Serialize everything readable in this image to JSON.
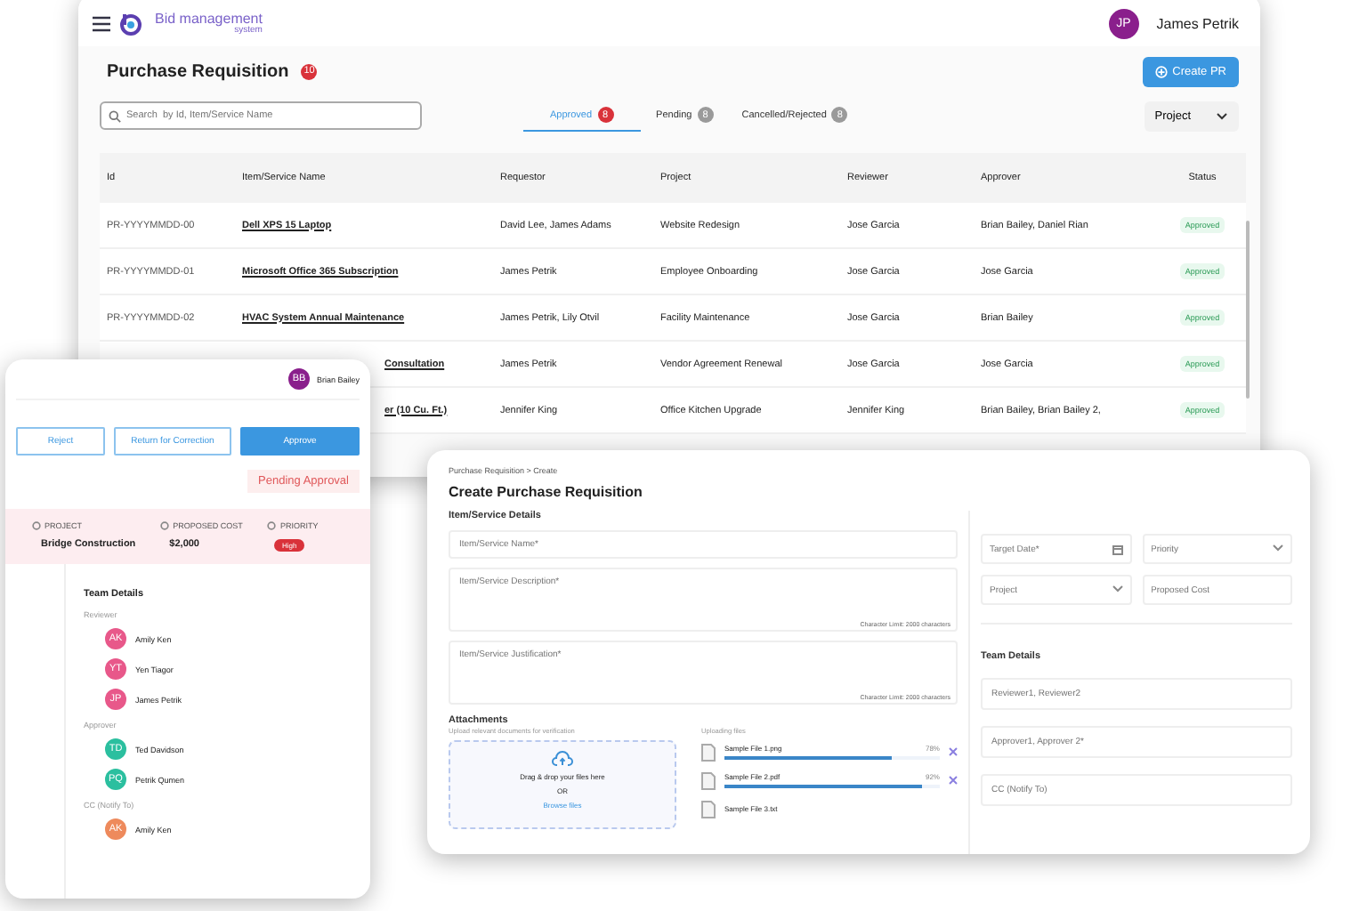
{
  "main_window": {
    "app": {
      "name": "Bid management",
      "tagline": "system"
    },
    "user": {
      "initials": "JP",
      "name": "James Petrik"
    },
    "page": {
      "title": "Purchase Requisition",
      "count": "10",
      "create_button": "Create PR"
    },
    "search": {
      "placeholder": "Search  by Id, Item/Service Name"
    },
    "tabs": [
      {
        "label": "Approved",
        "count": "8",
        "selected": true
      },
      {
        "label": "Pending",
        "count": "8",
        "selected": false
      },
      {
        "label": "Cancelled/Rejected",
        "count": "8",
        "selected": false
      }
    ],
    "filter": {
      "label": "Project"
    },
    "table": {
      "columns": [
        "Id",
        "Item/Service Name",
        "Requestor",
        "Project",
        "Reviewer",
        "Approver",
        "Status"
      ],
      "rows": [
        {
          "id": "PR-YYYYMMDD-00",
          "item": "Dell XPS 15 Laptop",
          "requestor": "David Lee, James Adams",
          "project": "Website Redesign",
          "reviewer": "Jose Garcia",
          "approver": "Brian Bailey, Daniel Rian",
          "status": "Approved"
        },
        {
          "id": "PR-YYYYMMDD-01",
          "item": "Microsoft Office 365 Subscription",
          "requestor": "James Petrik",
          "project": "Employee Onboarding",
          "reviewer": "Jose Garcia",
          "approver": "Jose Garcia",
          "status": "Approved"
        },
        {
          "id": "PR-YYYYMMDD-02",
          "item": "HVAC System Annual Maintenance",
          "requestor": "James Petrik, Lily Otvil",
          "project": "Facility Maintenance",
          "reviewer": "Jose Garcia",
          "approver": "Brian Bailey",
          "status": "Approved"
        },
        {
          "item": "Consultation",
          "requestor": "James Petrik",
          "project": "Vendor Agreement Renewal",
          "reviewer": "Jose Garcia",
          "approver": "Jose Garcia",
          "status": "Approved"
        },
        {
          "item": "er (10 Cu. Ft.)",
          "requestor": "Jennifer King",
          "project": "Office Kitchen Upgrade",
          "reviewer": "Jennifer King",
          "approver": "Brian Bailey, Brian Bailey 2,",
          "status": "Approved"
        }
      ]
    }
  },
  "review_panel": {
    "user": {
      "initials": "BB",
      "name": "Brian Bailey"
    },
    "actions": [
      {
        "label": "Reject",
        "kind": "outline"
      },
      {
        "label": "Return for Correction",
        "kind": "outline"
      },
      {
        "label": "Approve",
        "kind": "primary"
      }
    ],
    "status": "Pending Approval",
    "summary": [
      {
        "label": "PROJECT",
        "value": "Bridge Construction",
        "kind": "text"
      },
      {
        "label": "PROPOSED COST",
        "value": "$2,000",
        "kind": "text"
      },
      {
        "label": "PRIORITY",
        "value": "High",
        "kind": "tag"
      }
    ],
    "team_title": "Team Details",
    "groups": [
      {
        "label": "Reviewer",
        "members": [
          {
            "initials": "AK",
            "name": "Amily Ken",
            "color": "#e8588a"
          },
          {
            "initials": "YT",
            "name": "Yen Tiagor",
            "color": "#e8588a"
          },
          {
            "initials": "JP",
            "name": "James Petrik",
            "color": "#e8588a"
          }
        ]
      },
      {
        "label": "Approver",
        "members": [
          {
            "initials": "TD",
            "name": "Ted Davidson",
            "color": "#2bbf9f"
          },
          {
            "initials": "PQ",
            "name": "Petrik Qumen",
            "color": "#2bbf9f"
          }
        ]
      },
      {
        "label": "CC (Notify To)",
        "members": [
          {
            "initials": "AK",
            "name": "Amily Ken",
            "color": "#ee8a5c"
          }
        ]
      }
    ]
  },
  "create_form": {
    "breadcrumb": "Purchase Requisition > Create",
    "title": "Create Purchase Requisition",
    "section": "Item/Service Details",
    "fields": [
      {
        "placeholder": "Item/Service Name*",
        "kind": "input"
      },
      {
        "placeholder": "Item/Service Description*",
        "kind": "textarea",
        "hint": "Character Limit: 2000 characters"
      },
      {
        "placeholder": "Item/Service Justification*",
        "kind": "textarea",
        "hint": "Character Limit: 2000 characters"
      }
    ],
    "attachments": {
      "title": "Attachments",
      "subtitle": "Upload relevant documents for verification",
      "drop_text": "Drag & drop your files here",
      "or": "OR",
      "browse": "Browse files",
      "uploading_label": "Uploading files",
      "files": [
        {
          "name": "Sample File 1.png",
          "percent": "78%",
          "level": 0.78
        },
        {
          "name": "Sample File 2.pdf",
          "percent": "92%",
          "level": 0.92
        },
        {
          "name": "Sample File 3.txt"
        }
      ]
    },
    "side_fields": [
      {
        "placeholder": "Target Date*",
        "kind": "date"
      },
      {
        "placeholder": "Priority",
        "kind": "select"
      },
      {
        "placeholder": "Project",
        "kind": "select"
      },
      {
        "placeholder": "Proposed Cost",
        "kind": "input"
      }
    ],
    "team_title": "Team Details",
    "team_fields": [
      {
        "placeholder": "Reviewer1, Reviewer2"
      },
      {
        "placeholder": "Approver1, Approver 2*"
      },
      {
        "placeholder": "CC (Notify To)"
      }
    ]
  }
}
